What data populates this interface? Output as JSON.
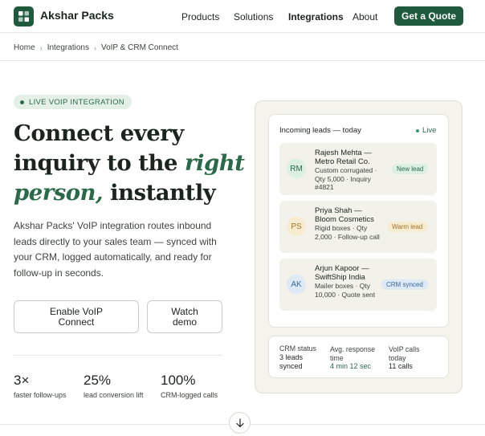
{
  "brand": {
    "name": "Akshar Packs"
  },
  "nav": {
    "products": "Products",
    "solutions": "Solutions",
    "integrations": "Integrations",
    "about": "About",
    "cta": "Get a Quote"
  },
  "breadcrumb": [
    "Home",
    "Integrations",
    "VoIP & CRM Connect"
  ],
  "hero": {
    "pill": "LIVE VOIP INTEGRATION",
    "title_line1": "Connect every",
    "title_line2_a": "inquiry to the ",
    "title_line2_b": "right",
    "title_line3_a": "person,",
    "title_line3_b": " instantly",
    "description": "Akshar Packs' VoIP integration routes inbound leads directly to your sales team — synced with your CRM, logged automatically, and ready for follow-up in seconds.",
    "primary_button": "Enable VoIP Connect",
    "secondary_button": "Watch demo"
  },
  "stats": [
    {
      "value": "3×",
      "label": "faster follow-ups"
    },
    {
      "value": "25%",
      "label": "lead conversion lift"
    },
    {
      "value": "100%",
      "label": "CRM-logged calls"
    }
  ],
  "leads_panel": {
    "title": "Incoming leads — today",
    "live": "Live",
    "leads": [
      {
        "initials": "RM",
        "name": "Rajesh Mehta — Metro Retail Co.",
        "info": "Custom corrugated · Qty 5,000 · Inquiry #4821",
        "badge": "New lead"
      },
      {
        "initials": "PS",
        "name": "Priya Shah — Bloom Cosmetics",
        "info": "Rigid boxes · Qty 2,000 · Follow-up call",
        "badge": "Warm lead"
      },
      {
        "initials": "AK",
        "name": "Arjun Kapoor — SwiftShip India",
        "info": "Mailer boxes · Qty 10,000 · Quote sent",
        "badge": "CRM synced"
      }
    ]
  },
  "crm": {
    "status_label": "CRM status",
    "status_value": "3 leads synced",
    "response_label": "Avg. response time",
    "response_value": "4 min 12 sec",
    "calls_label": "VoIP calls today",
    "calls_value": "11 calls"
  },
  "colors": {
    "accent": "#1f5a3d",
    "accent_text": "#2a6a48",
    "panel_bg": "#f4f3ec",
    "badge_new": "#dcefe3",
    "badge_warm": "#f7ecd0",
    "badge_crm": "#dde9f5"
  },
  "icons": {
    "logo": "grid-logo-icon",
    "scroll": "arrow-down-icon"
  }
}
